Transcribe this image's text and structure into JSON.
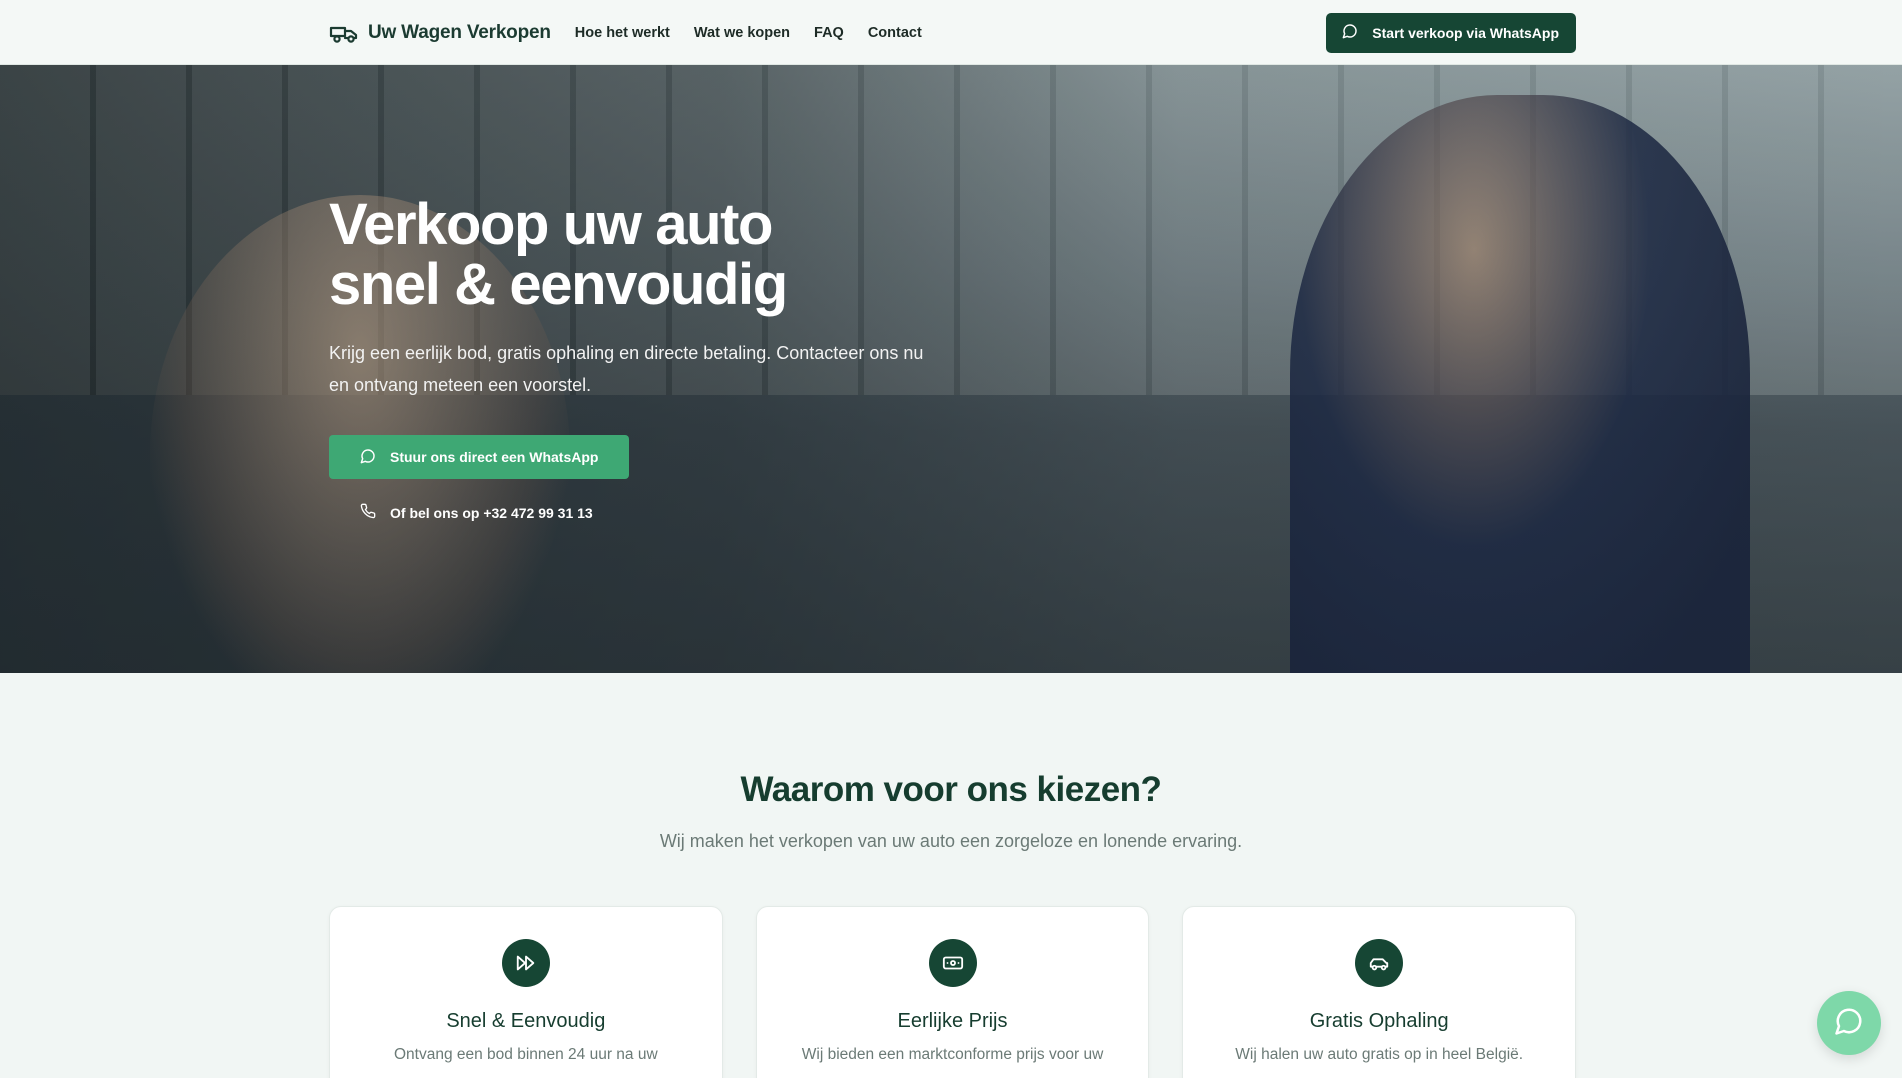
{
  "nav": {
    "brand": "Uw Wagen Verkopen",
    "links": [
      "Hoe het werkt",
      "Wat we kopen",
      "FAQ",
      "Contact"
    ],
    "cta": "Start verkoop via WhatsApp"
  },
  "hero": {
    "title_line1": "Verkoop uw auto",
    "title_line2": "snel & eenvoudig",
    "subtitle": "Krijg een eerlijk bod, gratis ophaling en directe betaling. Contacteer ons nu en ontvang meteen een voorstel.",
    "cta": "Stuur ons direct een WhatsApp",
    "phone": "Of bel ons op +32 472 99 31 13"
  },
  "why": {
    "title": "Waarom voor ons kiezen?",
    "subtitle": "Wij maken het verkopen van uw auto een zorgeloze en lonende ervaring.",
    "cards": [
      {
        "icon": "fast-forward-icon",
        "title": "Snel & Eenvoudig",
        "text": "Ontvang een bod binnen 24 uur na uw"
      },
      {
        "icon": "banknote-icon",
        "title": "Eerlijke Prijs",
        "text": "Wij bieden een marktconforme prijs voor uw"
      },
      {
        "icon": "car-icon",
        "title": "Gratis Ophaling",
        "text": "Wij halen uw auto gratis op in heel België."
      }
    ]
  },
  "colors": {
    "primary_dark": "#164634",
    "accent_green": "#3ea874",
    "fab_green": "#7ed8a9",
    "background": "#f1f6f4"
  },
  "icons": {
    "brand": "truck-icon",
    "whatsapp": "chat-bubble-icon",
    "phone": "phone-icon"
  }
}
